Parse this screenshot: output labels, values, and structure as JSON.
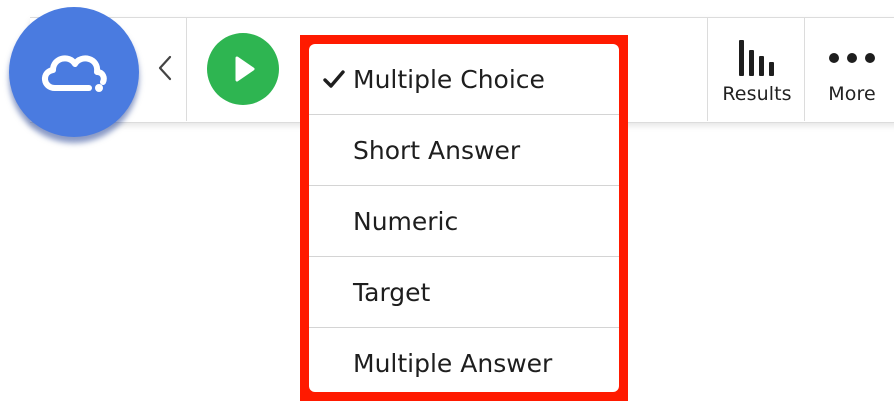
{
  "toolbar": {
    "results_label": "Results",
    "more_label": "More"
  },
  "question_type_menu": {
    "items": [
      {
        "label": "Multiple Choice",
        "selected": true
      },
      {
        "label": "Short Answer",
        "selected": false
      },
      {
        "label": "Numeric",
        "selected": false
      },
      {
        "label": "Target",
        "selected": false
      },
      {
        "label": "Multiple Answer",
        "selected": false
      }
    ],
    "highlight_color": "#ff1a00"
  },
  "colors": {
    "logo_blue": "#4a7be0",
    "play_green": "#2eb551"
  },
  "icons": {
    "logo": "cloud-icon",
    "back": "chevron-left-icon",
    "play": "play-icon",
    "results": "bar-chart-icon",
    "more": "more-dots-icon",
    "check": "check-icon"
  }
}
